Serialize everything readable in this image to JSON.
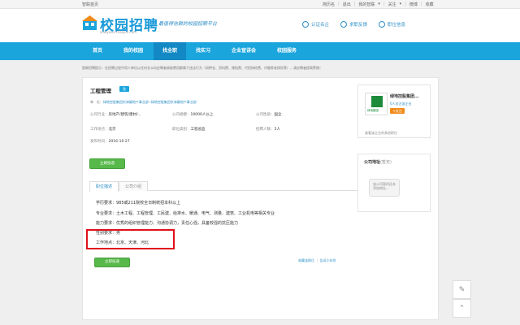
{
  "topbar": {
    "home": "智联首页",
    "links": [
      "简历名",
      "退出",
      "我的智联",
      "关注",
      "微博",
      "收藏"
    ]
  },
  "header": {
    "logo_title": "校园招聘",
    "logo_sub": "xiaoyuan.zhaopin.com",
    "slogan": "最值得信赖的校园招聘平台",
    "links": [
      "认证名企",
      "求职反馈",
      "职位信息"
    ]
  },
  "nav": {
    "items": [
      "首页",
      "我的校园",
      "找全职",
      "找实习",
      "企业宣讲会",
      "校园服务"
    ],
    "active_index": 2
  },
  "notice": "智联招聘提示：在招聘过程中用人单位以任何名义向应聘者收取费用都属于违法行为（如押金、资料费、建档费、代招体检费、代缴养老保险等），请应聘者提高警惕！",
  "job": {
    "title": "工程管理",
    "tag": "急",
    "crumb_label": "单",
    "crumb_sep": "位：",
    "crumb_link": "绿地控股集团京津冀地产事业部--绿地控股集团京津冀地产事业部",
    "industry_label": "公司行业：",
    "industry": "房地产/建筑/建材/...",
    "size_label": "公司规模：",
    "size": "10000人以上",
    "nature_label": "公司性质：",
    "nature": "国企",
    "location_label": "工作地点：",
    "location": "北京",
    "category_label": "职位类别：",
    "category": "工程总监",
    "headcount_label": "招聘人数：",
    "headcount": "5人",
    "publish_label": "发布时间：",
    "publish": "2016-10-27",
    "apply_label": "立即投递"
  },
  "tabs": [
    "职位描述",
    "公司介绍"
  ],
  "description": [
    "学历要求：985或211院校全日制统招本科以上",
    "专业要求：土木工程、工程管理、工民建、给排水、暖通、电气、测量、建筑、工业机电等相关专业",
    "能力要求：优秀的组织管理能力、沟通协调力，责任心强，具备较强的抗压能力",
    "性别要求：男",
    "工作地点：北京、天津、河北"
  ],
  "bottom": {
    "apply_label": "立即投递",
    "links": [
      "收藏该职位",
      "告诉小伙伴"
    ]
  },
  "company_card": {
    "logo_text": "绿地集团",
    "name": "绿地控股集团...",
    "followers": "0人关注该企业",
    "follow_label": "+关注",
    "other_jobs": "查看该企业的其他职位"
  },
  "map": {
    "title": "公司地址",
    "title_note": "(暂无)",
    "bubble": "该公司暂时还未添加地址..."
  },
  "colors": {
    "brand": "#1ba5dd",
    "nav_active": "#1289c4",
    "apply_green": "#57b94a",
    "highlight_red": "#e0101a",
    "follow_orange": "#f08b1b"
  },
  "float_icons": [
    "pencil-icon",
    "chevron-up-icon"
  ]
}
